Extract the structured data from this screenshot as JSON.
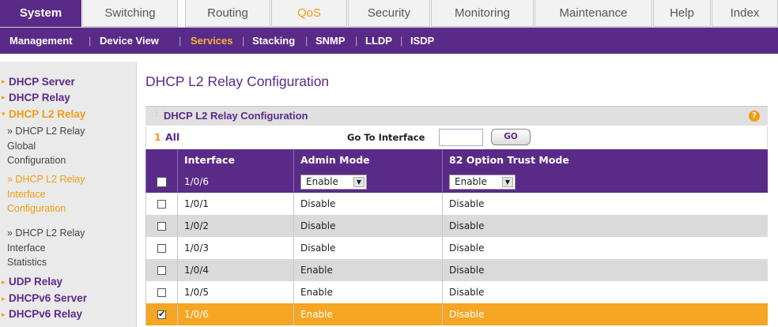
{
  "tabs": [
    {
      "label": "System",
      "state": "active"
    },
    {
      "label": "Switching",
      "state": ""
    },
    {
      "label": "Routing",
      "state": ""
    },
    {
      "label": "QoS",
      "state": "highlight"
    },
    {
      "label": "Security",
      "state": ""
    },
    {
      "label": "Monitoring",
      "state": ""
    },
    {
      "label": "Maintenance",
      "state": ""
    },
    {
      "label": "Help",
      "state": ""
    },
    {
      "label": "Index",
      "state": ""
    }
  ],
  "subnav": [
    {
      "label": "Management",
      "current": false
    },
    {
      "label": "Device View",
      "current": false
    },
    {
      "label": "Services",
      "current": true
    },
    {
      "label": "Stacking",
      "current": false
    },
    {
      "label": "SNMP",
      "current": false
    },
    {
      "label": "LLDP",
      "current": false
    },
    {
      "label": "ISDP",
      "current": false
    }
  ],
  "sidebar": {
    "categories": [
      "DHCP Server",
      "DHCP Relay",
      "DHCP L2 Relay",
      "UDP Relay",
      "DHCPv6 Server",
      "DHCPv6 Relay"
    ],
    "subitems": [
      [
        "» DHCP L2 Relay",
        "Global",
        "Configuration"
      ],
      [
        "» DHCP L2 Relay",
        "Interface",
        "Configuration"
      ],
      [
        "» DHCP L2 Relay",
        "Interface",
        "Statistics"
      ]
    ]
  },
  "page_title": "DHCP L2 Relay Configuration",
  "panel": {
    "title": "DHCP L2 Relay Configuration",
    "help": "?",
    "page_number": "1",
    "page_all": "All",
    "goto_label": "Go To Interface",
    "goto_value": "",
    "go_button": "GO"
  },
  "table": {
    "headers": [
      "Interface",
      "Admin Mode",
      "82 Option Trust Mode"
    ],
    "edit_row": {
      "interface": "1/0/6",
      "admin_mode": "Enable",
      "trust_mode": "Enable"
    },
    "rows": [
      {
        "interface": "1/0/1",
        "admin_mode": "Disable",
        "trust_mode": "Disable",
        "checked": false
      },
      {
        "interface": "1/0/2",
        "admin_mode": "Disable",
        "trust_mode": "Disable",
        "checked": false
      },
      {
        "interface": "1/0/3",
        "admin_mode": "Disable",
        "trust_mode": "Disable",
        "checked": false
      },
      {
        "interface": "1/0/4",
        "admin_mode": "Enable",
        "trust_mode": "Disable",
        "checked": false
      },
      {
        "interface": "1/0/5",
        "admin_mode": "Enable",
        "trust_mode": "Disable",
        "checked": false
      },
      {
        "interface": "1/0/6",
        "admin_mode": "Enable",
        "trust_mode": "Disable",
        "checked": true
      }
    ]
  },
  "colors": {
    "primary": "#5a2a88",
    "accent": "#f39c12",
    "selected_row": "#f5a623",
    "stripe": "#dadada"
  }
}
